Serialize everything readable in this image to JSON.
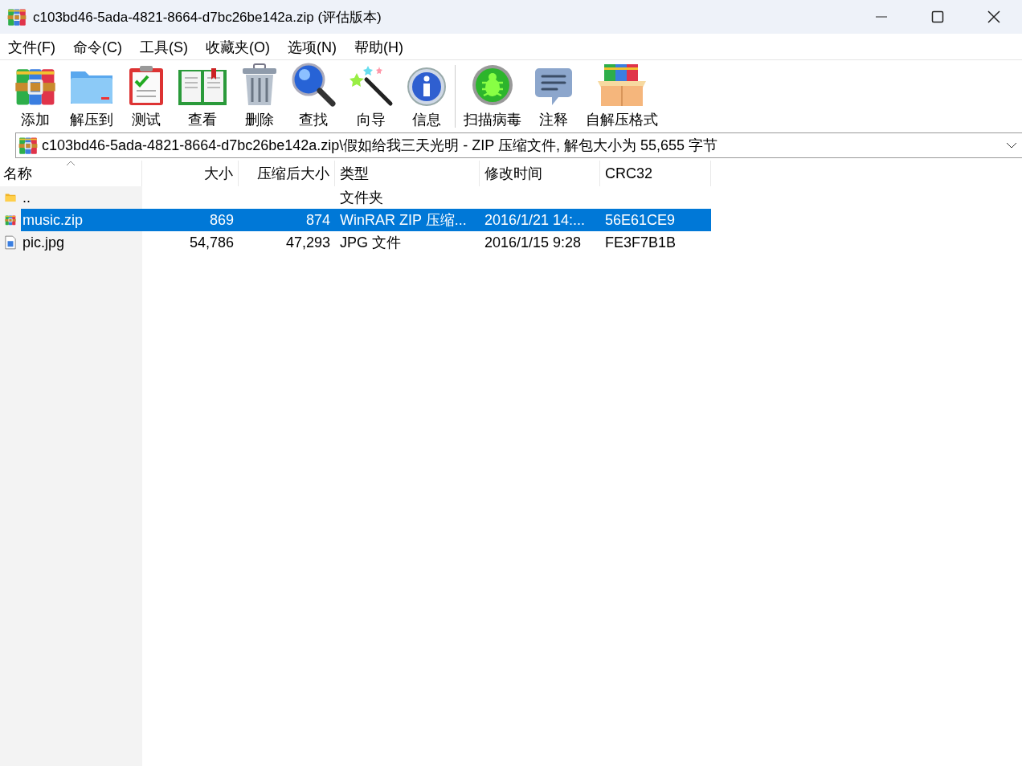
{
  "window": {
    "title": "c103bd46-5ada-4821-8664-d7bc26be142a.zip (评估版本)"
  },
  "menu": [
    "文件(F)",
    "命令(C)",
    "工具(S)",
    "收藏夹(O)",
    "选项(N)",
    "帮助(H)"
  ],
  "toolbar": [
    {
      "label": "添加"
    },
    {
      "label": "解压到"
    },
    {
      "label": "测试"
    },
    {
      "label": "查看"
    },
    {
      "label": "删除"
    },
    {
      "label": "查找"
    },
    {
      "label": "向导"
    },
    {
      "label": "信息"
    },
    {
      "label": "扫描病毒"
    },
    {
      "label": "注释"
    },
    {
      "label": "自解压格式"
    }
  ],
  "path": {
    "value": "c103bd46-5ada-4821-8664-d7bc26be142a.zip\\假如给我三天光明 - ZIP 压缩文件, 解包大小为 55,655 字节"
  },
  "columns": [
    {
      "label": "名称",
      "sorted": true
    },
    {
      "label": "大小",
      "sorted": false
    },
    {
      "label": "压缩后大小",
      "sorted": false
    },
    {
      "label": "类型",
      "sorted": false
    },
    {
      "label": "修改时间",
      "sorted": false
    },
    {
      "label": "CRC32",
      "sorted": false
    }
  ],
  "rows": [
    {
      "kind": "folder",
      "name": "..",
      "size": "",
      "packed": "",
      "type": "文件夹",
      "modified": "",
      "crc": "",
      "selected": false
    },
    {
      "kind": "archive",
      "name": "music.zip",
      "size": "869",
      "packed": "874",
      "type": "WinRAR ZIP 压缩...",
      "modified": "2016/1/21 14:...",
      "crc": "56E61CE9",
      "selected": true
    },
    {
      "kind": "image",
      "name": "pic.jpg",
      "size": "54,786",
      "packed": "47,293",
      "type": "JPG 文件",
      "modified": "2016/1/15 9:28",
      "crc": "FE3F7B1B",
      "selected": false
    }
  ]
}
